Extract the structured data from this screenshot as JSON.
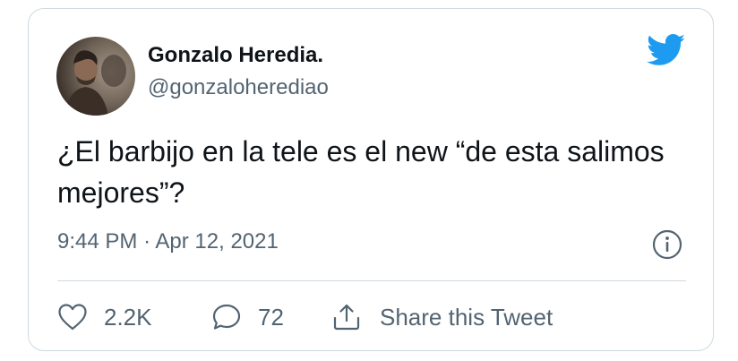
{
  "tweet": {
    "author_name": "Gonzalo Heredia.",
    "author_handle": "@gonzaloherediao",
    "text": "¿El barbijo en la tele es el new “de esta salimos mejores”?",
    "time": "9:44 PM",
    "separator": "·",
    "date": "Apr 12, 2021"
  },
  "actions": {
    "likes_count": "2.2K",
    "replies_count": "72",
    "share_label": "Share this Tweet"
  },
  "icons": {
    "brand": "twitter-bird-icon",
    "info": "info-icon",
    "like": "heart-icon",
    "reply": "speech-bubble-icon",
    "share": "share-upload-icon"
  },
  "colors": {
    "brand_blue": "#1d9bf0",
    "text_primary": "#0f1419",
    "text_secondary": "#536471",
    "border": "#cfd9de"
  }
}
